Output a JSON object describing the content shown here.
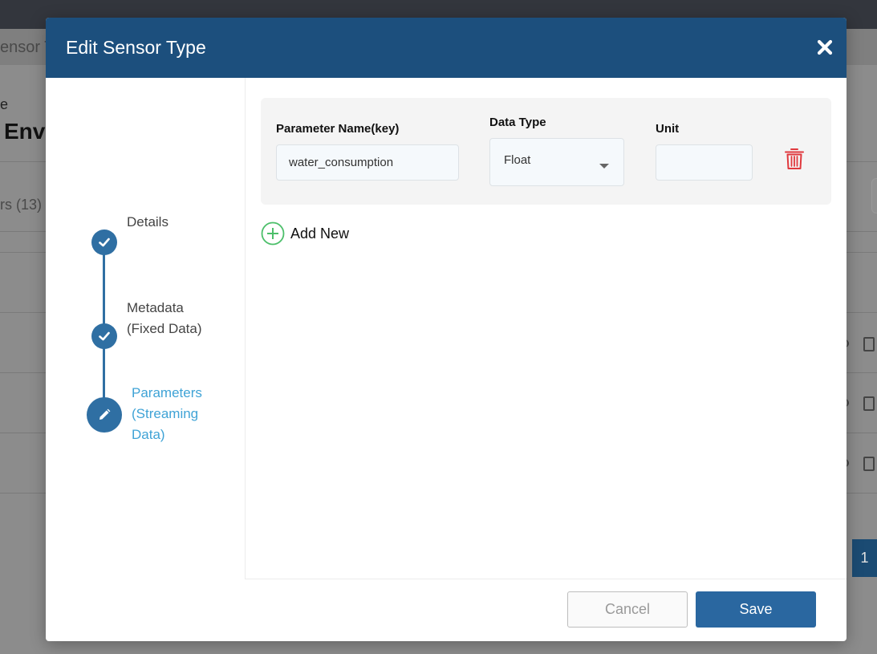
{
  "background": {
    "breadcrumb": "ensor T",
    "section_label": "e",
    "page_title": "Envi",
    "tab_label": "rs (13)",
    "pagination_page": "1"
  },
  "modal": {
    "title": "Edit Sensor Type",
    "close_icon": "close-icon"
  },
  "steps": [
    {
      "label_line1": "Details",
      "label_line2": "",
      "label_line3": "",
      "state": "done",
      "icon": "check-icon"
    },
    {
      "label_line1": "Metadata",
      "label_line2": "(Fixed Data)",
      "label_line3": "",
      "state": "done",
      "icon": "check-icon"
    },
    {
      "label_line1": "Parameters",
      "label_line2": "(Streaming",
      "label_line3": "Data)",
      "state": "active",
      "icon": "pencil-icon"
    }
  ],
  "parameter": {
    "name_label": "Parameter Name(key)",
    "name_value": "water_consumption",
    "type_label": "Data Type",
    "type_value": "Float",
    "unit_label": "Unit",
    "unit_value": ""
  },
  "add_new_label": "Add New",
  "footer": {
    "cancel_label": "Cancel",
    "save_label": "Save"
  },
  "colors": {
    "header": "#1c4f7d",
    "step_active": "#3fa3d6",
    "step_circle": "#2f6fa3",
    "add_icon": "#4cbf6a",
    "delete_icon": "#e0393e",
    "save_button": "#2a67a0"
  }
}
